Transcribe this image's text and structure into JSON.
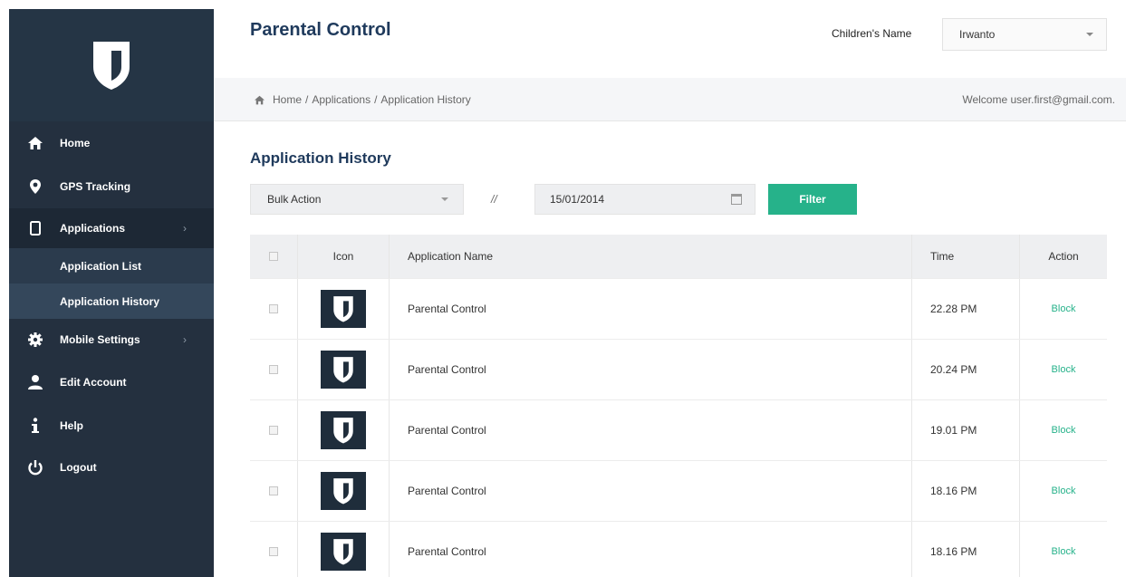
{
  "header": {
    "title": "Parental Control",
    "children_label": "Children's Name",
    "children_value": "Irwanto"
  },
  "breadcrumb": {
    "items": [
      "Home",
      "Applications",
      "Application History"
    ],
    "separator": "/",
    "welcome": "Welcome user.first@gmail.com."
  },
  "sidebar": {
    "items": [
      {
        "label": "Home",
        "icon": "home-icon"
      },
      {
        "label": "GPS Tracking",
        "icon": "location-pin-icon"
      },
      {
        "label": "Applications",
        "icon": "mobile-icon",
        "chevron": "›"
      },
      {
        "label": "Mobile Settings",
        "icon": "gear-icon",
        "chevron": "›"
      },
      {
        "label": "Edit Account",
        "icon": "user-icon"
      },
      {
        "label": "Help",
        "icon": "info-icon"
      },
      {
        "label": "Logout",
        "icon": "power-icon"
      }
    ],
    "sub_items": [
      {
        "label": "Application List"
      },
      {
        "label": "Application History"
      }
    ]
  },
  "main": {
    "section_title": "Application History",
    "bulk_action": "Bulk Action",
    "separator": "//",
    "date": "15/01/2014",
    "filter_label": "Filter",
    "columns": {
      "icon": "Icon",
      "name": "Application Name",
      "time": "Time",
      "action": "Action"
    },
    "rows": [
      {
        "name": "Parental Control",
        "time": "22.28 PM",
        "action": "Block"
      },
      {
        "name": "Parental Control",
        "time": "20.24 PM",
        "action": "Block"
      },
      {
        "name": "Parental Control",
        "time": "19.01 PM",
        "action": "Block"
      },
      {
        "name": "Parental Control",
        "time": "18.16 PM",
        "action": "Block"
      },
      {
        "name": "Parental Control",
        "time": "18.16 PM",
        "action": "Block"
      }
    ]
  },
  "colors": {
    "sidebar_bg": "#24303f",
    "accent": "#26b28a",
    "title": "#1f3a5c"
  }
}
